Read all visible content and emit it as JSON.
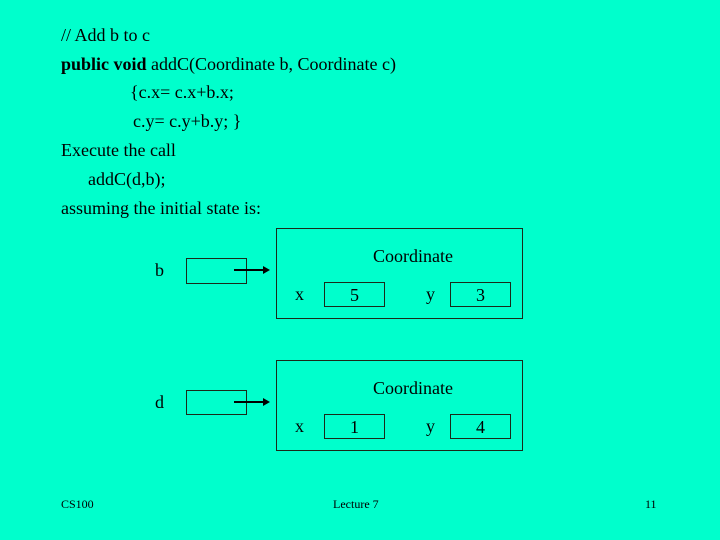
{
  "code": {
    "comment": "// Add b to c",
    "signature_keywords": "public void",
    "signature_rest": " addC(Coordinate b, Coordinate c)",
    "body_line1": "{c.x= c.x+b.x;",
    "body_line2": "c.y= c.y+b.y; }",
    "execute_label": "Execute the call",
    "call": "addC(d,b);",
    "assumption": "assuming the initial state is:"
  },
  "diagram": {
    "objects": [
      {
        "variable": "b",
        "class_name": "Coordinate",
        "fields": [
          {
            "name": "x",
            "value": "5"
          },
          {
            "name": "y",
            "value": "3"
          }
        ]
      },
      {
        "variable": "d",
        "class_name": "Coordinate",
        "fields": [
          {
            "name": "x",
            "value": "1"
          },
          {
            "name": "y",
            "value": "4"
          }
        ]
      }
    ]
  },
  "footer": {
    "left": "CS100",
    "center": "Lecture 7",
    "right": "11"
  },
  "colors": {
    "background": "#00FFCC",
    "text": "#000000"
  }
}
